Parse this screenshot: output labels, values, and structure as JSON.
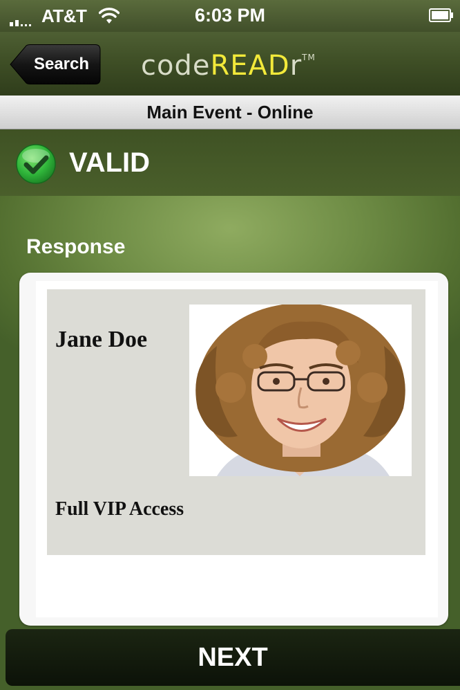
{
  "status_bar": {
    "carrier": "AT&T",
    "time": "6:03 PM"
  },
  "nav": {
    "back_label": "Search",
    "logo_prefix": "code",
    "logo_highlight": "READ",
    "logo_suffix": "r",
    "logo_mark": "TM"
  },
  "event": {
    "title": "Main Event - Online"
  },
  "result": {
    "status": "VALID",
    "icon": "check-circle-icon",
    "color": "#2fb53a"
  },
  "response": {
    "label": "Response",
    "name": "Jane Doe",
    "access": "Full VIP Access"
  },
  "actions": {
    "next_label": "NEXT"
  },
  "colors": {
    "logo_accent": "#f2e93a",
    "background": "#6e8c45"
  }
}
